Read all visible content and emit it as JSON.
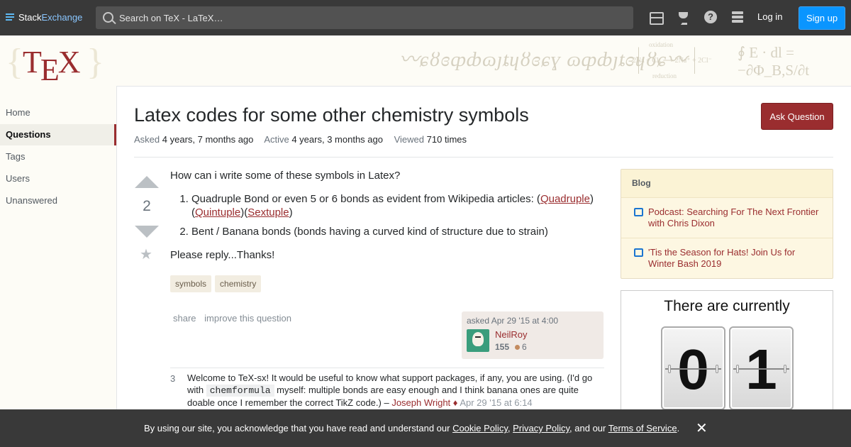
{
  "topbar": {
    "logo_stack": "Stack",
    "logo_exchange": "Exchange",
    "search_placeholder": "Search on TeX - LaTeX…",
    "login": "Log in",
    "signup": "Sign up",
    "icons": [
      "inbox-icon",
      "trophy-icon",
      "help-icon",
      "site-switcher-icon"
    ],
    "help_glyph": "?"
  },
  "site": {
    "logo_text": "TEX",
    "logo_t": "T",
    "logo_e": "E",
    "logo_x": "X",
    "brace_left": "{",
    "brace_right": "}",
    "deco_chem_top": "oxidation",
    "deco_chem_mid": "2Na + Cl₂ ⟶ 2Na⁺ + 2Cl⁻",
    "deco_chem_bottom": "reduction",
    "deco_formula": "∮ E · dl = −∂Φ_B,S/∂t"
  },
  "nav": {
    "items": [
      {
        "label": "Home"
      },
      {
        "label": "Questions"
      },
      {
        "label": "Tags"
      },
      {
        "label": "Users"
      },
      {
        "label": "Unanswered"
      }
    ],
    "active": "Questions"
  },
  "question": {
    "title": "Latex codes for some other chemistry symbols",
    "ask_button": "Ask Question",
    "asked_label": "Asked",
    "asked_value": "4 years, 7 months ago",
    "active_label": "Active",
    "active_value": "4 years, 3 months ago",
    "viewed_label": "Viewed",
    "viewed_value": "710 times",
    "score": "2",
    "intro": "How can i write some of these symbols in Latex?",
    "item1_text": "Quadruple Bond or even 5 or 6 bonds as evident from Wikipedia articles: (",
    "item1_link1": "Quadruple",
    "item1_mid1": ") (",
    "item1_link2": "Quintuple",
    "item1_mid2": ")(",
    "item1_link3": "Sextuple",
    "item1_end": ")",
    "item2_text": "Bent / Banana bonds (bonds having a curved kind of structure due to strain)",
    "closing": "Please reply...Thanks!",
    "tags": [
      "symbols",
      "chemistry"
    ],
    "menu_share": "share",
    "menu_improve": "improve this question",
    "owner_asked": "asked Apr 29 '15 at 4:00",
    "owner_name": "NeilRoy",
    "owner_rep": "155",
    "owner_bronze": "6"
  },
  "comment": {
    "score": "3",
    "text_before": "Welcome to TeX-sx! It would be useful to know what support packages, if any, you are using. (I'd go with ",
    "code": "chemformula",
    "text_after": " myself: multiple bonds are easy enough and I think banana ones are quite doable once I remember the correct TikZ code.) – ",
    "user": "Joseph Wright ♦",
    "date": "Apr 29 '15 at 6:14"
  },
  "blog": {
    "heading": "Blog",
    "items": [
      {
        "title": "Podcast: Searching For The Next Frontier with Chris Dixon"
      },
      {
        "title": "'Tis the Season for Hats! Join Us for Winter Bash 2019"
      }
    ]
  },
  "counter": {
    "title": "There are currently",
    "digits": [
      "0",
      "1"
    ]
  },
  "cookie": {
    "prefix": "By using our site, you acknowledge that you have read and understand our ",
    "cookie_policy": "Cookie Policy",
    "sep1": ", ",
    "privacy_policy": "Privacy Policy",
    "sep2": ", and our ",
    "terms": "Terms of Service",
    "suffix": ".",
    "close": "✕"
  }
}
